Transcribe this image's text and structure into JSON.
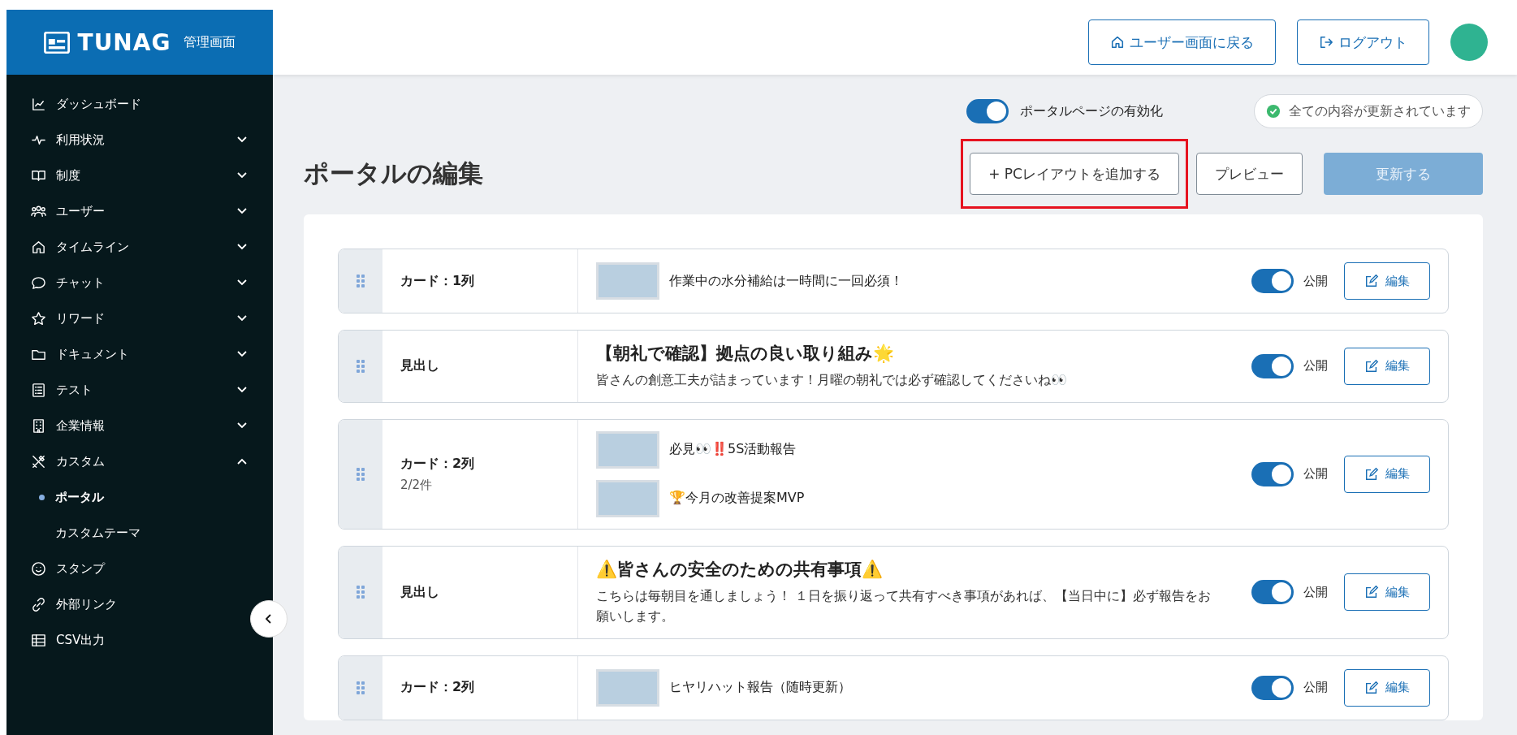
{
  "brand": {
    "logo": "TUNAG",
    "subtitle": "管理画面"
  },
  "header": {
    "buttons": [
      {
        "label": "ユーザー画面に戻る"
      },
      {
        "label": "ログアウト"
      }
    ]
  },
  "sidebar": {
    "items": [
      {
        "label": "ダッシュボード"
      },
      {
        "label": "利用状況",
        "expanded": false
      },
      {
        "label": "制度",
        "expanded": false
      },
      {
        "label": "ユーザー",
        "expanded": false
      },
      {
        "label": "タイムライン",
        "expanded": false
      },
      {
        "label": "チャット",
        "expanded": false
      },
      {
        "label": "リワード",
        "expanded": false
      },
      {
        "label": "ドキュメント",
        "expanded": false
      },
      {
        "label": "テスト",
        "expanded": false
      },
      {
        "label": "企業情報",
        "expanded": false
      },
      {
        "label": "カスタム",
        "expanded": true,
        "children": [
          {
            "label": "ポータル",
            "selected": true
          },
          {
            "label": "カスタムテーマ",
            "selected": false
          }
        ]
      },
      {
        "label": "スタンプ"
      },
      {
        "label": "外部リンク"
      },
      {
        "label": "CSV出力"
      }
    ]
  },
  "page": {
    "title": "ポータルの編集",
    "portal_enabled": {
      "label": "ポータルページの有効化",
      "on": true
    },
    "status": "全ての内容が更新されています",
    "actions": [
      {
        "label": "+ PCレイアウトを追加する",
        "kind": "outline",
        "highlighted": true
      },
      {
        "label": "プレビュー",
        "kind": "outline",
        "highlighted": false
      },
      {
        "label": "更新する",
        "kind": "primary",
        "disabled": true,
        "highlighted": false
      }
    ]
  },
  "rows": [
    {
      "type": "カード：1列",
      "kind": "cards",
      "items": [
        {
          "text": "作業中の水分補給は一時間に一回必須！"
        }
      ],
      "published": true,
      "publish_label": "公開",
      "edit_label": "編集"
    },
    {
      "type": "見出し",
      "kind": "heading",
      "title": "【朝礼で確認】拠点の良い取り組み🌟",
      "body": "皆さんの創意工夫が詰まっています！月曜の朝礼では必ず確認してくださいね👀",
      "published": true,
      "publish_label": "公開",
      "edit_label": "編集"
    },
    {
      "type": "カード：2列",
      "count": "2/2件",
      "kind": "cards",
      "items": [
        {
          "text": "必見👀‼️5S活動報告"
        },
        {
          "text": "🏆今月の改善提案MVP"
        }
      ],
      "published": true,
      "publish_label": "公開",
      "edit_label": "編集"
    },
    {
      "type": "見出し",
      "kind": "heading",
      "title": "⚠️皆さんの安全のための共有事項⚠️",
      "body": "こちらは毎朝目を通しましょう！ １日を振り返って共有すべき事項があれば、【当日中に】必ず報告をお願いします。",
      "published": true,
      "publish_label": "公開",
      "edit_label": "編集"
    },
    {
      "type": "カード：2列",
      "kind": "cards",
      "items": [
        {
          "text": "ヒヤリハット報告（随時更新）"
        }
      ],
      "published": true,
      "publish_label": "公開",
      "edit_label": "編集"
    }
  ]
}
